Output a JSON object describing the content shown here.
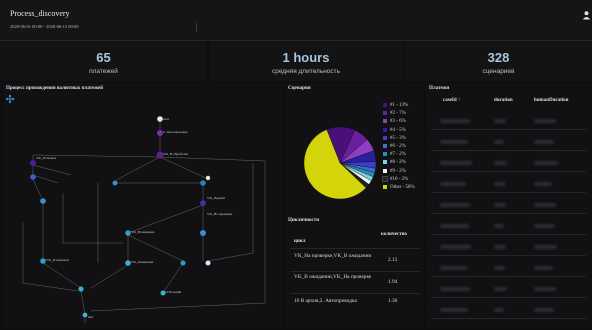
{
  "header": {
    "title": "Process_discovery",
    "date_range": "2020-06-01 00:00 - 2020-06-15 00:00"
  },
  "kpis": [
    {
      "value": "65",
      "label": "платежей"
    },
    {
      "value": "1 hours",
      "label": "средняя длительность"
    },
    {
      "value": "328",
      "label": "сценариев"
    }
  ],
  "graph_panel": {
    "title": "Процесс прохождения валютных платежей",
    "nodes": [
      {
        "label": "start"
      },
      {
        "label": "2. Автопроводка"
      },
      {
        "label": "VK_В обработке"
      },
      {
        "label": "VK_Отложен"
      },
      {
        "label": "VK_На проверке"
      },
      {
        "label": "VK_Принят"
      },
      {
        "label": "VK_Возвращен"
      },
      {
        "label": "VK_Отправлен"
      },
      {
        "label": "VK_Ожидание"
      },
      {
        "label": "10 В архив"
      },
      {
        "label": "end"
      }
    ]
  },
  "scenarios_panel": {
    "title": "Сценарии",
    "legend": [
      {
        "label": "#1 - 13%",
        "color": "#4b0f7a"
      },
      {
        "label": "#2 - 7%",
        "color": "#6a1fa0"
      },
      {
        "label": "#3 - 6%",
        "color": "#8c3fc2"
      },
      {
        "label": "#4 - 5%",
        "color": "#2a1f9c"
      },
      {
        "label": "#5 - 3%",
        "color": "#3d3fd0"
      },
      {
        "label": "#6 - 2%",
        "color": "#3b6fd0"
      },
      {
        "label": "#7 - 2%",
        "color": "#2a8fb6"
      },
      {
        "label": "#8 - 2%",
        "color": "#7fd0e0"
      },
      {
        "label": "#9 - 2%",
        "color": "#e8f4f0"
      },
      {
        "label": "#10 - 2%",
        "color": "#202020"
      },
      {
        "label": "Other - 58%",
        "color": "#d4d40a"
      }
    ]
  },
  "cycles_panel": {
    "title": "Цикличности",
    "columns": [
      "цикл",
      "количество"
    ],
    "rows": [
      {
        "cycle": "VK_На проверке,VK_В ожидании",
        "count": "2.13"
      },
      {
        "cycle": "VK_В ожидании,VK_На проверке",
        "count": "1.94"
      },
      {
        "cycle": "10 В архив,2. Автопроводка",
        "count": "1.36"
      }
    ]
  },
  "payments_panel": {
    "title": "Платежи",
    "columns": [
      "caseId ↑",
      "duration",
      "humanDuration"
    ]
  }
}
